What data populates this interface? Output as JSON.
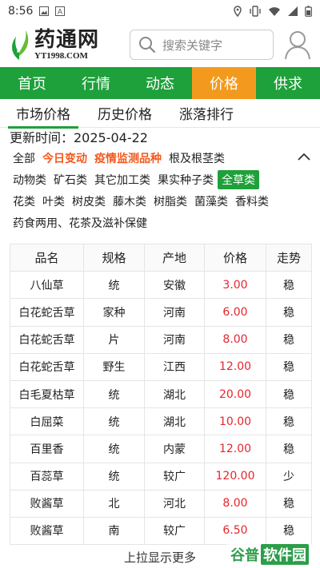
{
  "status_bar": {
    "time": "8:56",
    "left_icons": [
      "image-icon",
      "a-badge-icon"
    ],
    "right_icons": [
      "location-icon",
      "vibrate-icon",
      "wifi-icon",
      "signal-icon",
      "battery-icon"
    ]
  },
  "header": {
    "logo_cn": "药通网",
    "logo_en": "YT1998.COM",
    "search_placeholder": "搜索关键字"
  },
  "main_nav": [
    {
      "label": "首页",
      "active": false
    },
    {
      "label": "行情",
      "active": false
    },
    {
      "label": "动态",
      "active": false
    },
    {
      "label": "价格",
      "active": true
    },
    {
      "label": "供求",
      "active": false
    }
  ],
  "sub_tabs": [
    {
      "label": "市场价格",
      "active": true
    },
    {
      "label": "历史价格",
      "active": false
    },
    {
      "label": "涨落排行",
      "active": false
    }
  ],
  "update": {
    "text": "更新时间：2025-04-22"
  },
  "categories": {
    "row1": [
      "全部",
      "今日变动",
      "疫情监测品种",
      "根及根茎类"
    ],
    "row2": [
      "动物类",
      "矿石类",
      "其它加工类",
      "果实种子类",
      "全草类"
    ],
    "row3": [
      "花类",
      "叶类",
      "树皮类",
      "藤木类",
      "树脂类",
      "菌藻类",
      "香料类"
    ],
    "row4": [
      "药食两用、花茶及滋补保健"
    ],
    "highlighted": [
      "今日变动",
      "疫情监测品种"
    ],
    "selected": "全草类"
  },
  "table": {
    "headers": [
      "品名",
      "规格",
      "产地",
      "价格",
      "走势"
    ],
    "rows": [
      [
        "八仙草",
        "统",
        "安徽",
        "3.00",
        "稳"
      ],
      [
        "白花蛇舌草",
        "家种",
        "河南",
        "6.00",
        "稳"
      ],
      [
        "白花蛇舌草",
        "片",
        "河南",
        "8.00",
        "稳"
      ],
      [
        "白花蛇舌草",
        "野生",
        "江西",
        "12.00",
        "稳"
      ],
      [
        "白毛夏枯草",
        "统",
        "湖北",
        "20.00",
        "稳"
      ],
      [
        "白屈菜",
        "统",
        "湖北",
        "10.00",
        "稳"
      ],
      [
        "百里香",
        "统",
        "内蒙",
        "12.00",
        "稳"
      ],
      [
        "百蕊草",
        "统",
        "较广",
        "120.00",
        "少"
      ],
      [
        "败酱草",
        "北",
        "河北",
        "8.00",
        "稳"
      ],
      [
        "败酱草",
        "南",
        "较广",
        "6.50",
        "稳"
      ]
    ]
  },
  "footer": {
    "more_label": "上拉显示更多"
  },
  "watermark": {
    "text1": "谷普",
    "text2": "软件园"
  },
  "colors": {
    "brand_green": "#1ea03a",
    "active_orange": "#f39a1e",
    "price_red": "#e5262e",
    "highlight_orange": "#f3591e"
  }
}
